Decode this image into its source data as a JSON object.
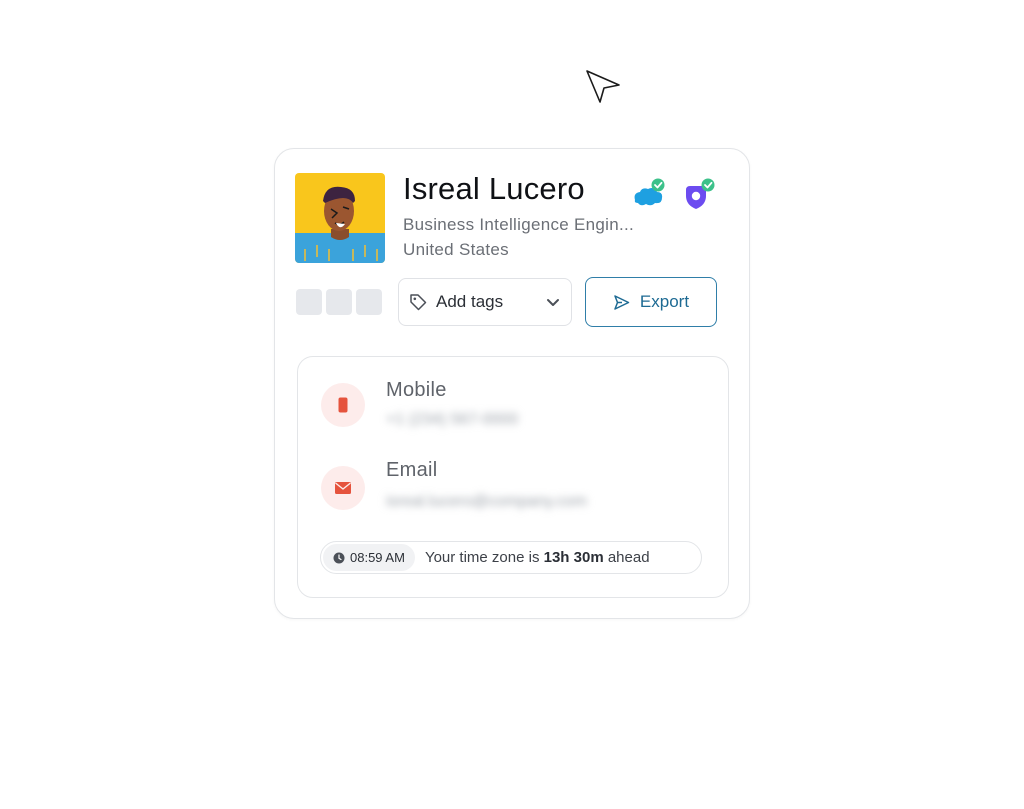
{
  "profile": {
    "name": "Isreal Lucero",
    "title": "Business Intelligence Engin...",
    "location": "United States"
  },
  "integrations": [
    {
      "icon": "salesforce-cloud-icon",
      "color": "#1ea0e1",
      "status": "connected"
    },
    {
      "icon": "shield-icon",
      "color": "#6c4cf0",
      "status": "connected"
    }
  ],
  "actions": {
    "tags_label": "Add tags",
    "export_label": "Export"
  },
  "contact": {
    "mobile_label": "Mobile",
    "mobile_value": "+1 (234) 567-0000",
    "email_label": "Email",
    "email_value": "isreal.lucero@company.com"
  },
  "timezone": {
    "local_time": "08:59 AM",
    "prefix": "Your time zone is ",
    "offset": "13h 30m",
    "suffix": " ahead"
  },
  "colors": {
    "accent": "#2f7ea8",
    "contact_icon": "#e5533d",
    "check_badge": "#3cc18a"
  }
}
